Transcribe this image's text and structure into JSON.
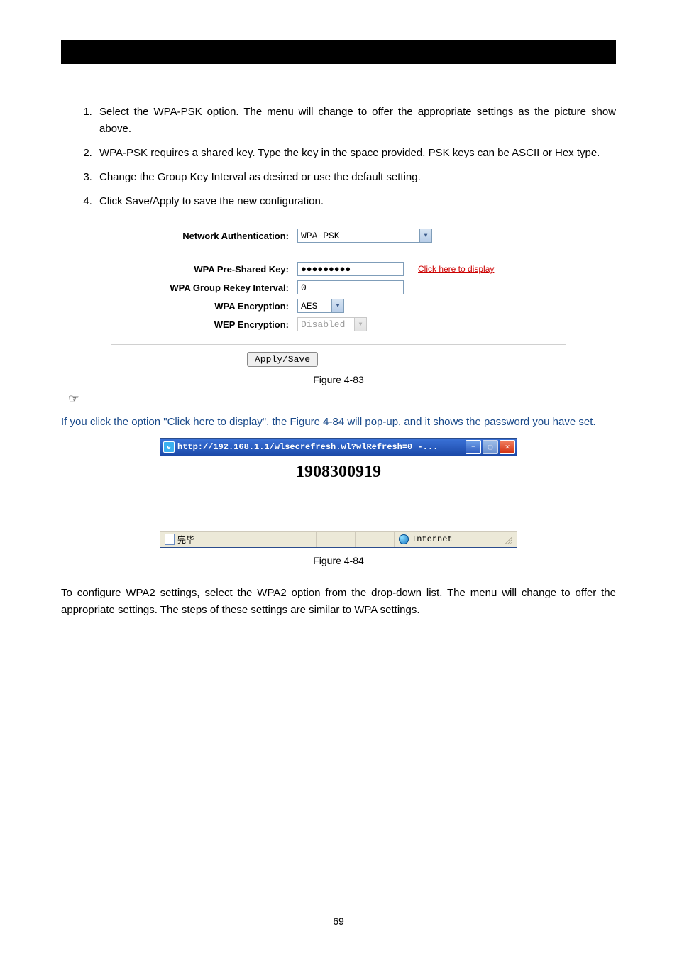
{
  "blackbar_rendered": true,
  "list": {
    "items": [
      "Select the WPA-PSK option. The menu will change to offer the appropriate settings as the picture show above.",
      "WPA-PSK requires a shared key. Type the key in the space provided. PSK keys can be ASCII or Hex type.",
      "Change the Group Key Interval as desired or use the default setting.",
      "Click Save/Apply to save the new configuration."
    ]
  },
  "form": {
    "labels": {
      "auth": "Network Authentication:",
      "psk": "WPA Pre-Shared Key:",
      "gri": "WPA Group Rekey Interval:",
      "wpaenc": "WPA Encryption:",
      "wepenc": "WEP Encryption:"
    },
    "values": {
      "auth": "WPA-PSK",
      "psk": "●●●●●●●●●",
      "gri": "0",
      "wpaenc": "AES",
      "wepenc": "Disabled"
    },
    "display_link": "Click here to display",
    "apply": "Apply/Save"
  },
  "captions": {
    "fig1": "Figure 4-83",
    "fig2": "Figure 4-84"
  },
  "pointer_icon": "☞",
  "note": {
    "pre": "If you click the option ",
    "link": "\"Click here to display\"",
    "post": ", the Figure 4-84 will pop-up, and it shows the password you have set."
  },
  "popup": {
    "title": "http://192.168.1.1/wlsecrefresh.wl?wlRefresh=0 -...",
    "ie_icon": "e",
    "minimize_sym": "–",
    "maximize_sym": "▢",
    "close_sym": "✕",
    "password": "1908300919",
    "status_done": "完毕",
    "zone": "Internet"
  },
  "wpa2_para": "To configure WPA2 settings, select the WPA2 option from the drop-down list. The menu will change to offer the appropriate settings. The steps of these settings are similar to WPA settings.",
  "page_number": "69"
}
